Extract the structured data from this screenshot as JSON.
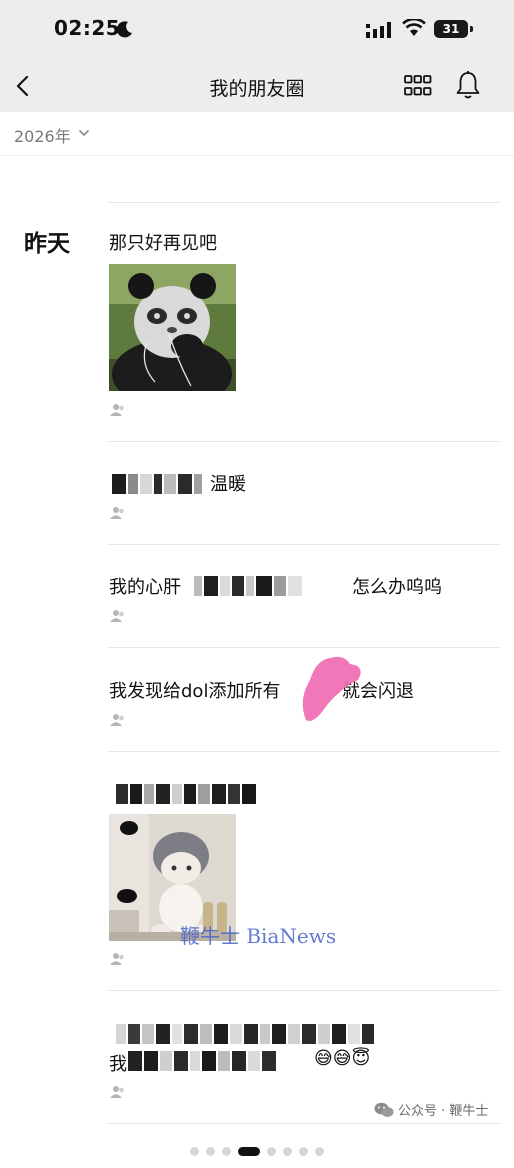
{
  "status_bar": {
    "time": "02:25",
    "battery": "31"
  },
  "nav": {
    "title": "我的朋友圈"
  },
  "year_filter": {
    "label": "2026年"
  },
  "day_label": "昨天",
  "posts": [
    {
      "text": "那只好再见吧"
    },
    {
      "text_visible": "温暖"
    },
    {
      "text_prefix": "我的心肝",
      "text_suffix": "怎么办呜呜"
    },
    {
      "text_prefix": "我发现给dol添加所有",
      "text_suffix": "就会闪退"
    },
    {
      "text_visible": ""
    },
    {
      "text_prefix": "我"
    }
  ],
  "watermark": "鞭牛士 BiaNews",
  "wechat_watermark": "公众号 · 鞭牛士",
  "emoji": [
    "😅",
    "😅",
    "😇"
  ],
  "page_dots": {
    "count": 8,
    "active_index": 3
  },
  "colors": {
    "bar_bg": "#ededed",
    "text_primary": "#111111",
    "text_secondary": "#7a7a7a",
    "divider": "#e6e6e6",
    "scribble": "#f06bb2"
  },
  "icons": [
    "back-chevron-icon",
    "grid-icon",
    "bell-icon",
    "privacy-person-icon",
    "moon-icon",
    "signal-icon",
    "wifi-icon"
  ]
}
